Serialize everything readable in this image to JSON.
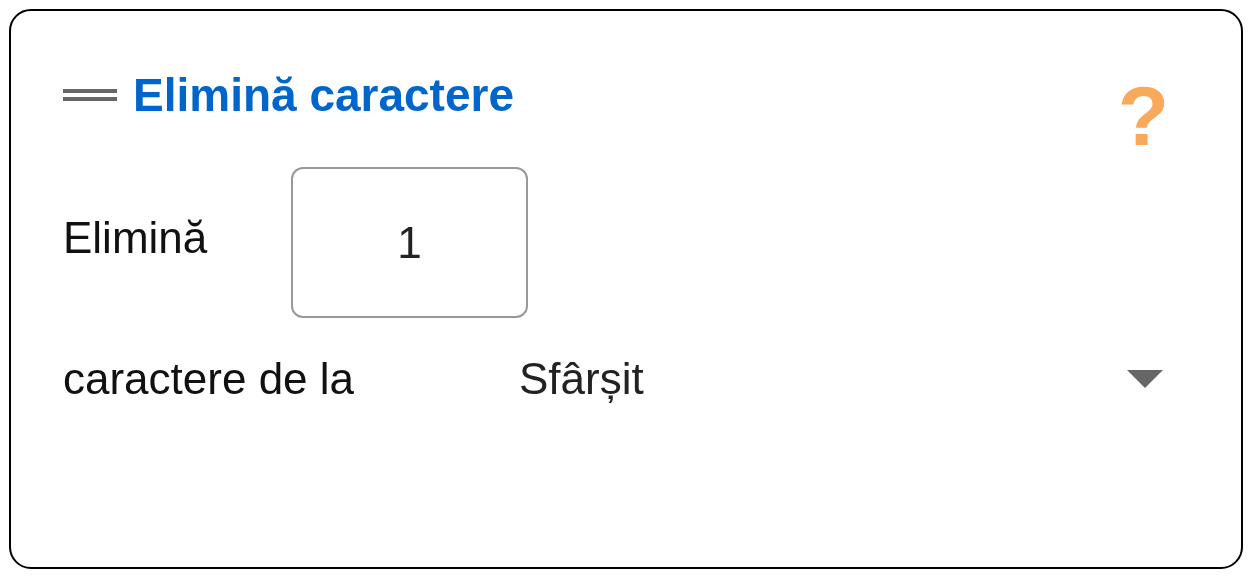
{
  "header": {
    "title": "Elimină caractere",
    "help": "?"
  },
  "count_row": {
    "label": "Elimină",
    "value": "1"
  },
  "position_row": {
    "label": "caractere de la",
    "value": "Sfârșit"
  }
}
